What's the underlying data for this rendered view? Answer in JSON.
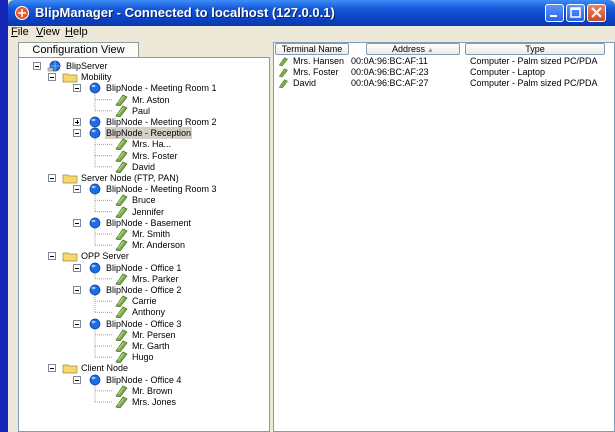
{
  "window": {
    "title": "BlipManager - Connected to localhost (127.0.0.1)"
  },
  "menu": {
    "file": "File",
    "view": "View",
    "help": "Help"
  },
  "left_tab": {
    "label": "Configuration View"
  },
  "tree": {
    "root": "BlipServer",
    "groups": [
      {
        "name": "Mobility",
        "nodes": [
          {
            "name": "BlipNode - Meeting Room 1",
            "expanded": true,
            "terminals": [
              "Mr. Aston",
              "Paul"
            ]
          },
          {
            "name": "BlipNode - Meeting Room 2",
            "expanded": false,
            "terminals": []
          },
          {
            "name": "BlipNode - Reception",
            "expanded": true,
            "selected": true,
            "terminals": [
              "Mrs. Ha...",
              "Mrs. Foster",
              "David"
            ]
          }
        ]
      },
      {
        "name": "Server Node (FTP, PAN)",
        "nodes": [
          {
            "name": "BlipNode - Meeting Room 3",
            "expanded": true,
            "terminals": [
              "Bruce",
              "Jennifer"
            ]
          },
          {
            "name": "BlipNode - Basement",
            "expanded": true,
            "terminals": [
              "Mr. Smith",
              "Mr. Anderson"
            ]
          }
        ]
      },
      {
        "name": "OPP Server",
        "nodes": [
          {
            "name": "BlipNode - Office 1",
            "expanded": true,
            "terminals": [
              "Mrs. Parker"
            ]
          },
          {
            "name": "BlipNode - Office 2",
            "expanded": true,
            "terminals": [
              "Carrie",
              "Anthony"
            ]
          },
          {
            "name": "BlipNode - Office 3",
            "expanded": true,
            "terminals": [
              "Mr. Persen",
              "Mr. Garth",
              "Hugo"
            ]
          }
        ]
      },
      {
        "name": "Client Node",
        "nodes": [
          {
            "name": "BlipNode - Office 4",
            "expanded": true,
            "terminals": [
              "Mr. Brown",
              "Mrs. Jones"
            ]
          }
        ]
      }
    ]
  },
  "table": {
    "headers": {
      "terminal": "Terminal Name",
      "address": "Address",
      "type": "Type"
    },
    "sort_indicator": "▲",
    "rows": [
      {
        "name": "Mrs. Hansen",
        "address": "00:0A:96:BC:AF:11",
        "type": "Computer - Palm sized PC/PDA"
      },
      {
        "name": "Mrs. Foster",
        "address": "00:0A:96:BC:AF:23",
        "type": "Computer - Laptop"
      },
      {
        "name": "David",
        "address": "00:0A:96:BC:AF:27",
        "type": "Computer - Palm sized PC/PDA"
      }
    ]
  },
  "colors": {
    "desktop": "#1626b8",
    "titlebar": "#0a3fbf",
    "node_blue": "#1a6fe8",
    "folder": "#f5d86a",
    "terminal_green": "#7fb04a",
    "selection": "#d4d0c8"
  }
}
